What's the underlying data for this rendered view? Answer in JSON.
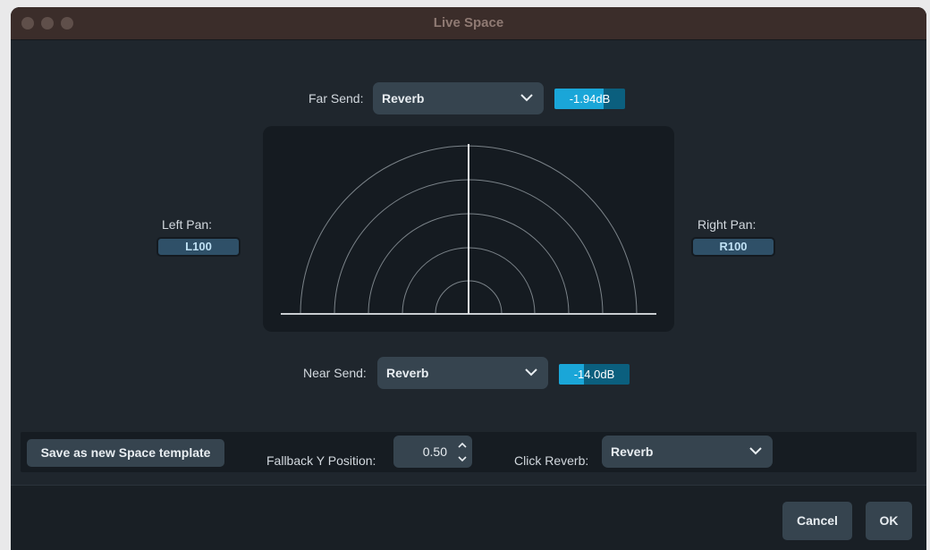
{
  "window": {
    "title": "Live Space"
  },
  "far_send": {
    "label": "Far Send:",
    "value": "Reverb",
    "level_text": "-1.94dB",
    "level_fraction": 0.7
  },
  "near_send": {
    "label": "Near Send:",
    "value": "Reverb",
    "level_text": "-14.0dB",
    "level_fraction": 0.36
  },
  "left_pan": {
    "label": "Left Pan:",
    "value": "L100"
  },
  "right_pan": {
    "label": "Right Pan:",
    "value": "R100"
  },
  "bottom_bar": {
    "save_template_label": "Save as new Space template",
    "fallback_label": "Fallback Y Position:",
    "fallback_value": "0.50",
    "click_reverb_label": "Click Reverb:",
    "click_reverb_value": "Reverb"
  },
  "footer": {
    "cancel_label": "Cancel",
    "ok_label": "OK"
  },
  "colors": {
    "accent": "#1aa6d8",
    "meter_bg": "#0b5f7e",
    "window_bg": "#1f262d",
    "titlebar": "#3b2d2a"
  }
}
